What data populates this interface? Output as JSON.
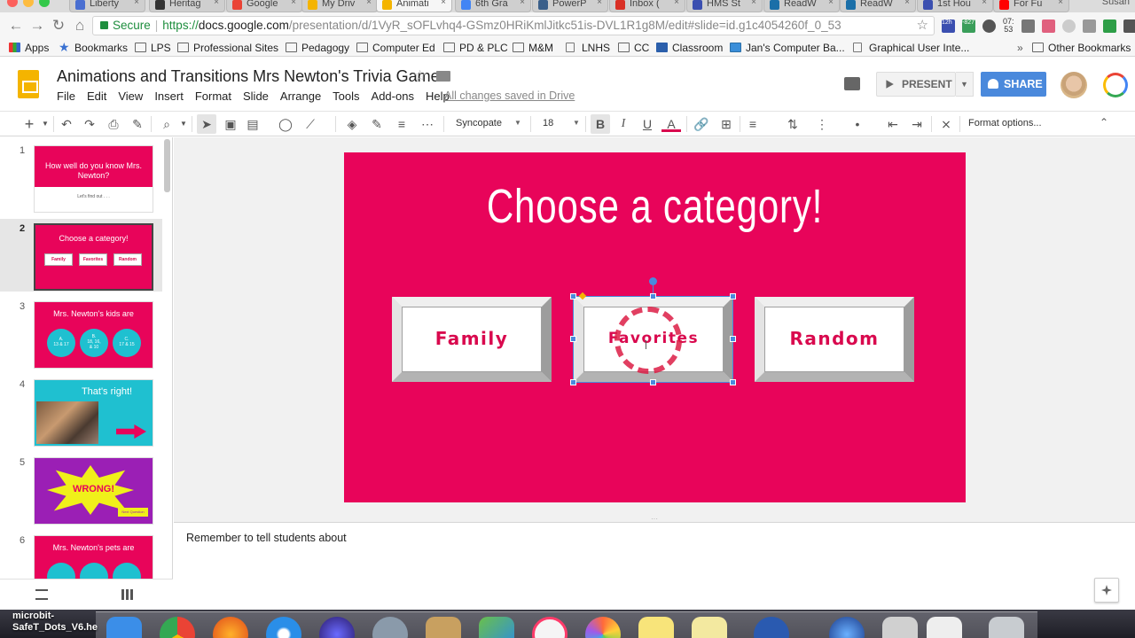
{
  "browser": {
    "tabs": [
      {
        "label": "Liberty",
        "color": "#4a6fd1"
      },
      {
        "label": "Heritag",
        "color": "#333333"
      },
      {
        "label": "Google",
        "color": "#ea4335"
      },
      {
        "label": "My Driv",
        "color": "#f4b400"
      },
      {
        "label": "Animati",
        "color": "#f4b400",
        "active": true
      },
      {
        "label": "6th Gra",
        "color": "#4285f4"
      },
      {
        "label": "PowerP",
        "color": "#3a5f8a"
      },
      {
        "label": "Inbox (",
        "color": "#d93025"
      },
      {
        "label": "HMS St",
        "color": "#3b4fb0"
      },
      {
        "label": "ReadW",
        "color": "#1b6fa8"
      },
      {
        "label": "ReadW",
        "color": "#1b6fa8"
      },
      {
        "label": "1st Hou",
        "color": "#3b4fb0"
      },
      {
        "label": "For Fu",
        "color": "#ff0000"
      }
    ],
    "profile_name": "Susan",
    "secure_label": "Secure",
    "url_scheme": "https://",
    "url_host": "docs.google.com",
    "url_path": "/presentation/d/1VyR_sOFLvhq4-GSmz0HRiKmlJitkc51is-DVL1R1g8M/edit#slide=id.g1c4054260f_0_53",
    "ext_badges": {
      "clock_top": "07:",
      "clock_bottom": "53",
      "badge1": "12h",
      "badge2": "-827"
    },
    "bookmarks": [
      {
        "label": "Apps",
        "icon": "apps-grid-icon"
      },
      {
        "label": "Bookmarks",
        "icon": "star-icon"
      },
      {
        "label": "LPS",
        "icon": "folder-icon"
      },
      {
        "label": "Professional Sites",
        "icon": "folder-icon"
      },
      {
        "label": "Pedagogy",
        "icon": "folder-icon"
      },
      {
        "label": "Computer Ed",
        "icon": "folder-icon"
      },
      {
        "label": "PD & PLC",
        "icon": "folder-icon"
      },
      {
        "label": "M&M",
        "icon": "folder-icon"
      },
      {
        "label": "LNHS",
        "icon": "page-icon"
      },
      {
        "label": "CC",
        "icon": "folder-icon"
      },
      {
        "label": "Classroom",
        "icon": "classroom-icon"
      },
      {
        "label": "Jan's Computer Ba...",
        "icon": "screen-icon"
      },
      {
        "label": "Graphical User Inte...",
        "icon": "page-icon"
      }
    ],
    "bookmarks_overflow": "»",
    "other_bookmarks": "Other Bookmarks"
  },
  "docs": {
    "title": "Animations and Transitions Mrs Newton's Trivia Game",
    "menu": [
      "File",
      "Edit",
      "View",
      "Insert",
      "Format",
      "Slide",
      "Arrange",
      "Tools",
      "Add-ons",
      "Help"
    ],
    "saved_status": "All changes saved in Drive",
    "present_label": "PRESENT",
    "share_label": "SHARE",
    "brand_color": "#f4b400",
    "accent_color": "#4a89dc"
  },
  "toolbar": {
    "font": "Syncopate",
    "size": "18",
    "format_options": "Format options...",
    "icons": [
      "plus-icon",
      "undo-icon",
      "redo-icon",
      "print-icon",
      "paint-format-icon",
      "zoom-icon",
      "select-icon",
      "textbox-icon",
      "image-icon",
      "shape-icon",
      "line-icon",
      "fill-color-icon",
      "border-color-icon",
      "border-weight-icon",
      "border-dash-icon",
      "bold-icon",
      "italic-icon",
      "underline-icon",
      "text-color-icon",
      "link-icon",
      "comment-icon",
      "align-icon",
      "line-spacing-icon",
      "numbered-list-icon",
      "bulleted-list-icon",
      "decrease-indent-icon",
      "increase-indent-icon",
      "clear-formatting-icon"
    ]
  },
  "filmstrip": [
    {
      "num": "1",
      "title": "How well do you know Mrs. Newton?",
      "sub": "Let's find out . . .",
      "bg": "#e8045a"
    },
    {
      "num": "2",
      "title": "Choose a category!",
      "buttons": [
        "Family",
        "Favorites",
        "Random"
      ],
      "bg": "#e8045a"
    },
    {
      "num": "3",
      "title": "Mrs. Newton's kids are",
      "options": [
        "A.\n13 & 17",
        "B.\n18, 16,\n& 10",
        "C.\n17 & 15"
      ],
      "bg": "#e8045a"
    },
    {
      "num": "4",
      "title": "That's right!",
      "bg": "#1fc0d0"
    },
    {
      "num": "5",
      "title": "WRONG!",
      "sub": "Next Question",
      "bg": "#9b1fb5"
    },
    {
      "num": "6",
      "title": "Mrs. Newton's pets are",
      "bg": "#e8045a"
    }
  ],
  "slide": {
    "title": "Choose a category!",
    "bg_color": "#e8045a",
    "buttons": [
      "Family",
      "Favorites",
      "Random"
    ]
  },
  "notes": {
    "text": "Remember to tell students about"
  },
  "desktop": {
    "file_label_1": "microbit-",
    "file_label_2": "SafeT_Dots_V6.he"
  }
}
